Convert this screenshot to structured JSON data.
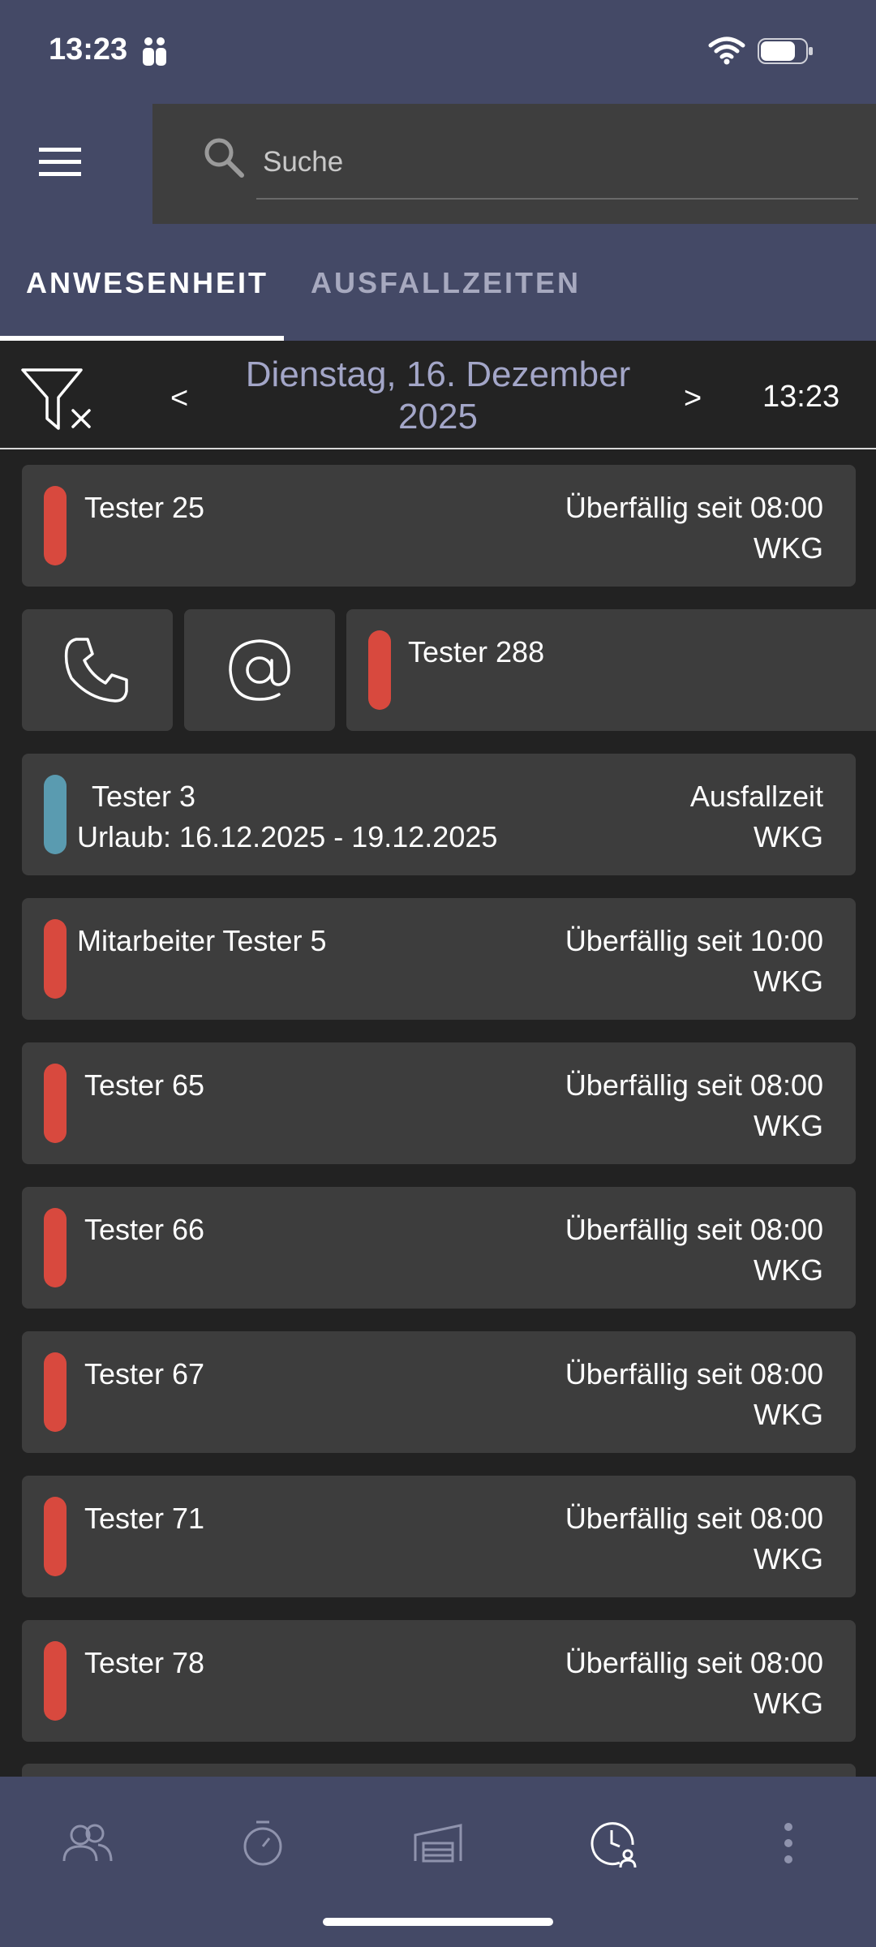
{
  "status_bar": {
    "time": "13:23"
  },
  "search": {
    "placeholder": "Suche"
  },
  "tabs": [
    {
      "label": "ANWESENHEIT",
      "active": true
    },
    {
      "label": "AUSFALLZEITEN",
      "active": false
    }
  ],
  "date_bar": {
    "prev": "<",
    "date_line1": "Dienstag, 16. Dezember",
    "date_line2": "2025",
    "next": ">",
    "time": "13:23"
  },
  "entries": [
    {
      "name": "Tester 25",
      "status": "Überfällig seit 08:00",
      "site": "WKG",
      "indicator": "red"
    },
    {
      "name": "Tester 288",
      "indicator": "red",
      "swiped": true
    },
    {
      "name": "Tester 3",
      "sub": "Urlaub: 16.12.2025 - 19.12.2025",
      "status": "Ausfallzeit",
      "site": "WKG",
      "indicator": "blue"
    },
    {
      "name": "Mitarbeiter Tester 5",
      "status": "Überfällig seit 10:00",
      "site": "WKG",
      "indicator": "red"
    },
    {
      "name": "Tester 65",
      "status": "Überfällig seit 08:00",
      "site": "WKG",
      "indicator": "red"
    },
    {
      "name": "Tester 66",
      "status": "Überfällig seit 08:00",
      "site": "WKG",
      "indicator": "red"
    },
    {
      "name": "Tester 67",
      "status": "Überfällig seit 08:00",
      "site": "WKG",
      "indicator": "red"
    },
    {
      "name": "Tester 71",
      "status": "Überfällig seit 08:00",
      "site": "WKG",
      "indicator": "red"
    },
    {
      "name": "Tester 78",
      "status": "Überfällig seit 08:00",
      "site": "WKG",
      "indicator": "red"
    }
  ],
  "bottom_nav": [
    {
      "icon": "people-icon"
    },
    {
      "icon": "stopwatch-icon"
    },
    {
      "icon": "garage-icon"
    },
    {
      "icon": "clock-user-icon",
      "active": true
    },
    {
      "icon": "more-vert-icon"
    }
  ],
  "colors": {
    "header": "#444966",
    "background": "#222222",
    "card": "#3d3d3d",
    "overdue": "#d8493e",
    "absence": "#5a9bb0",
    "date_text": "#a3a6c8"
  }
}
